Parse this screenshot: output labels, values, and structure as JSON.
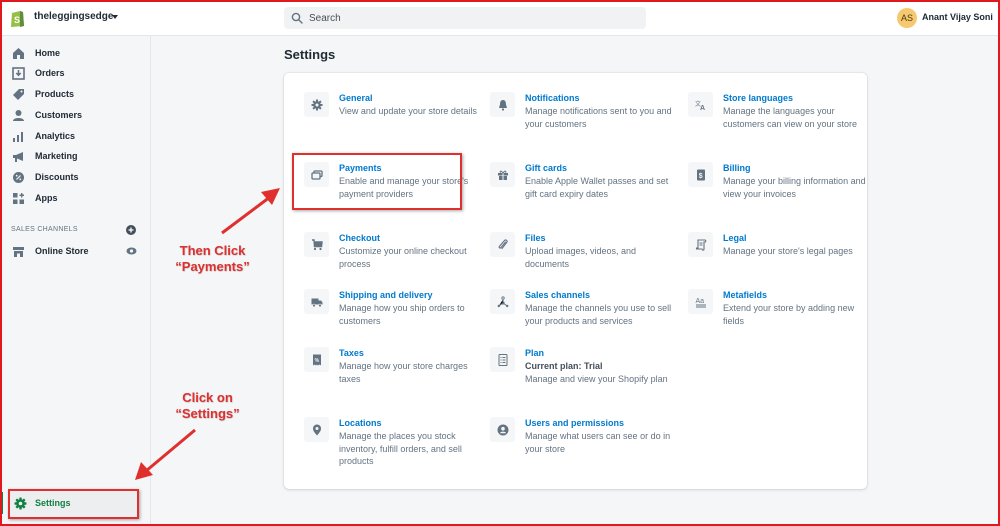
{
  "topbar": {
    "store_name": "theleggingsedge",
    "search_placeholder": "Search",
    "user_initials": "AS",
    "user_name": "Anant Vijay Soni"
  },
  "sidebar": {
    "items": [
      {
        "label": "Home",
        "icon": "home-icon"
      },
      {
        "label": "Orders",
        "icon": "orders-icon"
      },
      {
        "label": "Products",
        "icon": "tag-icon"
      },
      {
        "label": "Customers",
        "icon": "person-icon"
      },
      {
        "label": "Analytics",
        "icon": "bar-chart-icon"
      },
      {
        "label": "Marketing",
        "icon": "megaphone-icon"
      },
      {
        "label": "Discounts",
        "icon": "discount-badge-icon"
      },
      {
        "label": "Apps",
        "icon": "apps-grid-icon"
      }
    ],
    "sales_channels_label": "SALES CHANNELS",
    "channels": [
      {
        "label": "Online Store",
        "icon": "store-icon"
      }
    ],
    "settings_label": "Settings"
  },
  "main": {
    "title": "Settings",
    "tiles": [
      {
        "title": "General",
        "desc": "View and update your store details",
        "icon": "gear-icon"
      },
      {
        "title": "Notifications",
        "desc": "Manage notifications sent to you and your customers",
        "icon": "bell-icon"
      },
      {
        "title": "Store languages",
        "desc": "Manage the languages your customers can view on your store",
        "icon": "translate-icon"
      },
      {
        "title": "Payments",
        "desc": "Enable and manage your store's payment providers",
        "icon": "payment-card-icon"
      },
      {
        "title": "Gift cards",
        "desc": "Enable Apple Wallet passes and set gift card expiry dates",
        "icon": "gift-icon"
      },
      {
        "title": "Billing",
        "desc": "Manage your billing information and view your invoices",
        "icon": "billing-icon"
      },
      {
        "title": "Checkout",
        "desc": "Customize your online checkout process",
        "icon": "cart-icon"
      },
      {
        "title": "Files",
        "desc": "Upload images, videos, and documents",
        "icon": "paperclip-icon"
      },
      {
        "title": "Legal",
        "desc": "Manage your store's legal pages",
        "icon": "legal-scroll-icon"
      },
      {
        "title": "Shipping and delivery",
        "desc": "Manage how you ship orders to customers",
        "icon": "truck-icon"
      },
      {
        "title": "Sales channels",
        "desc": "Manage the channels you use to sell your products and services",
        "icon": "channels-icon"
      },
      {
        "title": "Metafields",
        "desc": "Extend your store by adding new fields",
        "icon": "metafields-icon"
      },
      {
        "title": "Taxes",
        "desc": "Manage how your store charges taxes",
        "icon": "tax-receipt-icon"
      },
      {
        "title": "Plan",
        "subtitle": "Current plan: Trial",
        "desc": "Manage and view your Shopify plan",
        "icon": "plan-icon"
      },
      {
        "title": "Locations",
        "desc": "Manage the places you stock inventory, fulfill orders, and sell products",
        "icon": "location-pin-icon"
      },
      {
        "title": "Users and permissions",
        "desc": "Manage what users can see or do in your store",
        "icon": "user-circle-icon"
      }
    ]
  },
  "annotations": {
    "payments_note_line1": "Then Click",
    "payments_note_line2": "“Payments”",
    "settings_note_line1": "Click on",
    "settings_note_line2": "“Settings”",
    "color": "#e0302e"
  },
  "colors": {
    "link": "#007ace",
    "active_green": "#108043",
    "avatar_bg": "#f6c86f"
  }
}
